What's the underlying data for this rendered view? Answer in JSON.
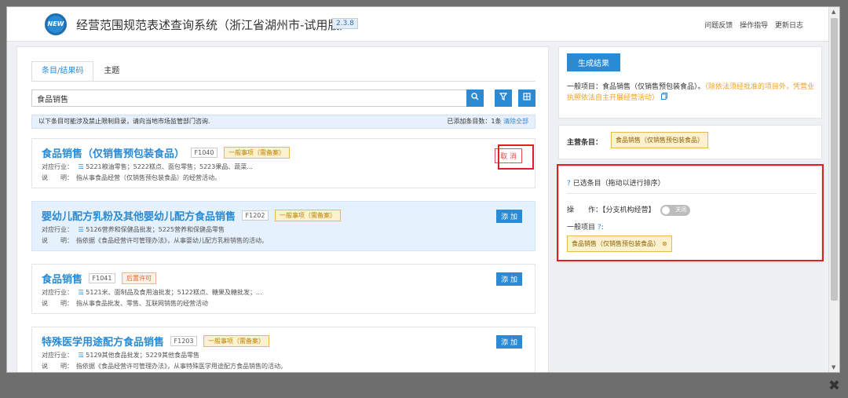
{
  "header": {
    "logo_text": "NEW",
    "title": "经营范围规范表述查询系统（浙江省湖州市-试用版）",
    "version": "2.3.8",
    "links": [
      "问题反馈",
      "操作指导",
      "更新日志"
    ]
  },
  "left": {
    "tabs": [
      "条目/结果码",
      "主题"
    ],
    "search_value": "食品销售",
    "icons": {
      "search": "search-icon",
      "filter": "filter-icon",
      "grid": "grid-icon"
    },
    "notice_text": "以下条目可能涉及禁止限制目录，请向当地市场监管部门咨询.",
    "added_count_text": "已添加条目数：1条",
    "clear_all": "清除全部",
    "items": [
      {
        "title": "食品销售（仅销售预包装食品）",
        "code": "F1040",
        "type": "一般事项（需备案）",
        "industry_label": "对应行业：",
        "industry_icon": "☰",
        "industry": "5221粮油零售；5222糕点、面包零售；5223果品、蔬菜...",
        "desc_label": "说　　明：",
        "desc": "指从事食品经营（仅销售预包装食品）的经营活动。",
        "action": "取 消"
      },
      {
        "title": "婴幼儿配方乳粉及其他婴幼儿配方食品销售",
        "code": "F1202",
        "type": "一般事项（需备案）",
        "industry_label": "对应行业：",
        "industry_icon": "☰",
        "industry": "5126营养和保健品批发；5225营养和保健品零售",
        "desc_label": "说　　明：",
        "desc": "指依据《食品经营许可管理办法》，从事婴幼儿配方乳粉销售的活动。",
        "action": "添 加"
      },
      {
        "title": "食品销售",
        "code": "F1041",
        "type": "后置许可",
        "industry_label": "对应行业：",
        "industry_icon": "☰",
        "industry": "5121米、面制品及食用油批发；5122糕点、糖果及糖批发；...",
        "desc_label": "说　　明：",
        "desc": "指从事食品批发、零售、互联网销售的经营活动",
        "action": "添 加"
      },
      {
        "title": "特殊医学用途配方食品销售",
        "code": "F1203",
        "type": "一般事项（需备案）",
        "industry_label": "对应行业：",
        "industry_icon": "☰",
        "industry": "5129其他食品批发；5229其他食品零售",
        "desc_label": "说　　明：",
        "desc": "指依据《食品经营许可管理办法》，从事特殊医学用途配方食品销售的活动。",
        "action": "添 加"
      }
    ]
  },
  "right": {
    "generate_label": "生成结果",
    "general_prefix": "一般项目：食品销售（仅销售预包装食品）。",
    "general_warn": "（除依法须经批准的项目外，凭营业执照依法自主开展经营活动）",
    "copy_icon": "copy-icon",
    "main_label": "主营条目：",
    "main_tag": "食品销售（仅销售预包装食品）",
    "selected_title": "已选条目（拖动以进行排序）",
    "selected_icon": "?",
    "op_label": "操　　作：",
    "op_text": "【分支机构经营】",
    "toggle_text": "关闭",
    "general_label": "一般项目",
    "general_icon": "?",
    "selected_tag": "食品销售（仅销售预包装食品）",
    "selected_tag_x": "⊗"
  },
  "window": {
    "close": "✖"
  },
  "colors": {
    "accent": "#2a8ad4",
    "warn": "#f0a020",
    "tag_bg": "#fdf1cf",
    "highlight": "#e02020"
  }
}
